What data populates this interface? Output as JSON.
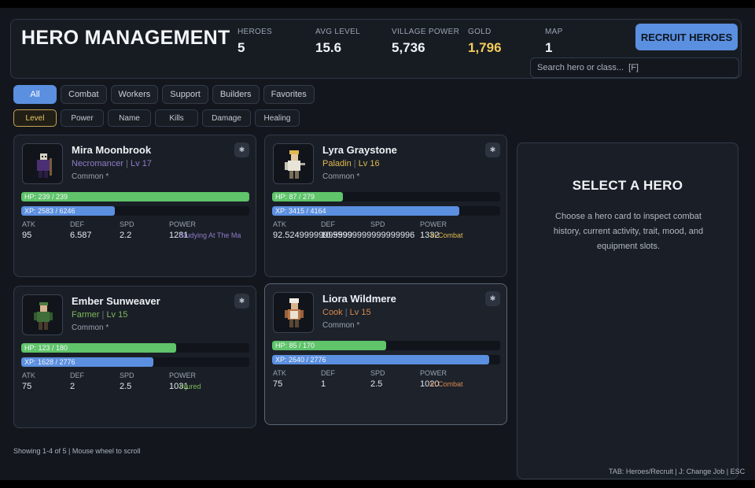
{
  "header": {
    "title": "HERO MANAGEMENT",
    "stats": [
      {
        "label": "HEROES",
        "value": "5"
      },
      {
        "label": "AVG LEVEL",
        "value": "15.6"
      },
      {
        "label": "VILLAGE POWER",
        "value": "5,736"
      },
      {
        "label": "GOLD",
        "value": "1,796"
      },
      {
        "label": "MAP",
        "value": "1"
      }
    ],
    "recruit_label": "RECRUIT HEROES",
    "search_placeholder": "Search hero or class...  [F]"
  },
  "filters": [
    "All",
    "Combat",
    "Workers",
    "Support",
    "Builders",
    "Favorites"
  ],
  "active_filter": "All",
  "sorts": [
    "Level",
    "Power",
    "Name",
    "Kills",
    "Damage",
    "Healing"
  ],
  "active_sort": "Level",
  "colors": {
    "accent": "#5b8fe0",
    "hp": "#5fc46a",
    "xp": "#5b8fe0",
    "gold": "#f2cb5a"
  },
  "stat_labels": {
    "atk": "ATK",
    "def": "DEF",
    "spd": "SPD",
    "power": "POWER"
  },
  "heroes": [
    {
      "name": "Mira Moonbrook",
      "class": "Necromancer",
      "level": "Lv 17",
      "sub_sep": " | ",
      "rarity": "Common *",
      "class_color": "#8f7bc9",
      "hp_text": "HP: 239 / 239",
      "hp_fraction": 1.0,
      "xp_text": "XP: 2583 / 6246",
      "xp_fraction": 0.41,
      "atk": "95",
      "def": "6.587",
      "spd": "2.2",
      "power": "1281",
      "activity": "Studying At The Ma",
      "activity_color": "#8f7bc9",
      "fav_icon": "star-icon"
    },
    {
      "name": "Lyra Graystone",
      "class": "Paladin",
      "level": "Lv 16",
      "sub_sep": " | ",
      "rarity": "Common *",
      "class_color": "#e0b84e",
      "hp_text": "HP: 87 / 279",
      "hp_fraction": 0.31,
      "xp_text": "XP: 3415 / 4164",
      "xp_fraction": 0.82,
      "atk": "92.52499999999999",
      "def": "10.55999999999999996",
      "spd": "",
      "power": "1332",
      "activity": "In Combat",
      "activity_color": "#e0b84e",
      "fav_icon": "star-icon"
    },
    {
      "name": "Ember Sunweaver",
      "class": "Farmer",
      "level": "Lv 15",
      "sub_sep": " | ",
      "rarity": "Common *",
      "class_color": "#7fb85a",
      "hp_text": "HP: 123 / 180",
      "hp_fraction": 0.68,
      "xp_text": "XP: 1628 / 2776",
      "xp_fraction": 0.58,
      "atk": "75",
      "def": "2",
      "spd": "2.5",
      "power": "1031",
      "activity": "Injured",
      "activity_color": "#7fb85a",
      "fav_icon": "star-icon"
    },
    {
      "name": "Liora Wildmere",
      "class": "Cook",
      "level": "Lv 15",
      "sub_sep": " | ",
      "rarity": "Common *",
      "class_color": "#d88a4e",
      "hp_text": "HP: 85 / 170",
      "hp_fraction": 0.5,
      "xp_text": "XP: 2640 / 2776",
      "xp_fraction": 0.95,
      "atk": "75",
      "def": "1",
      "spd": "2.5",
      "power": "1020",
      "activity": "In Combat",
      "activity_color": "#d88a4e",
      "fav_icon": "star-icon"
    }
  ],
  "detail": {
    "title": "SELECT A HERO",
    "desc": "Choose a hero card to inspect combat history, current activity, trait, mood, and equipment slots."
  },
  "footer": "Showing 1-4 of 5  |  Mouse wheel to scroll",
  "hint": "TAB: Heroes/Recruit  |  J: Change Job  |  ESC"
}
